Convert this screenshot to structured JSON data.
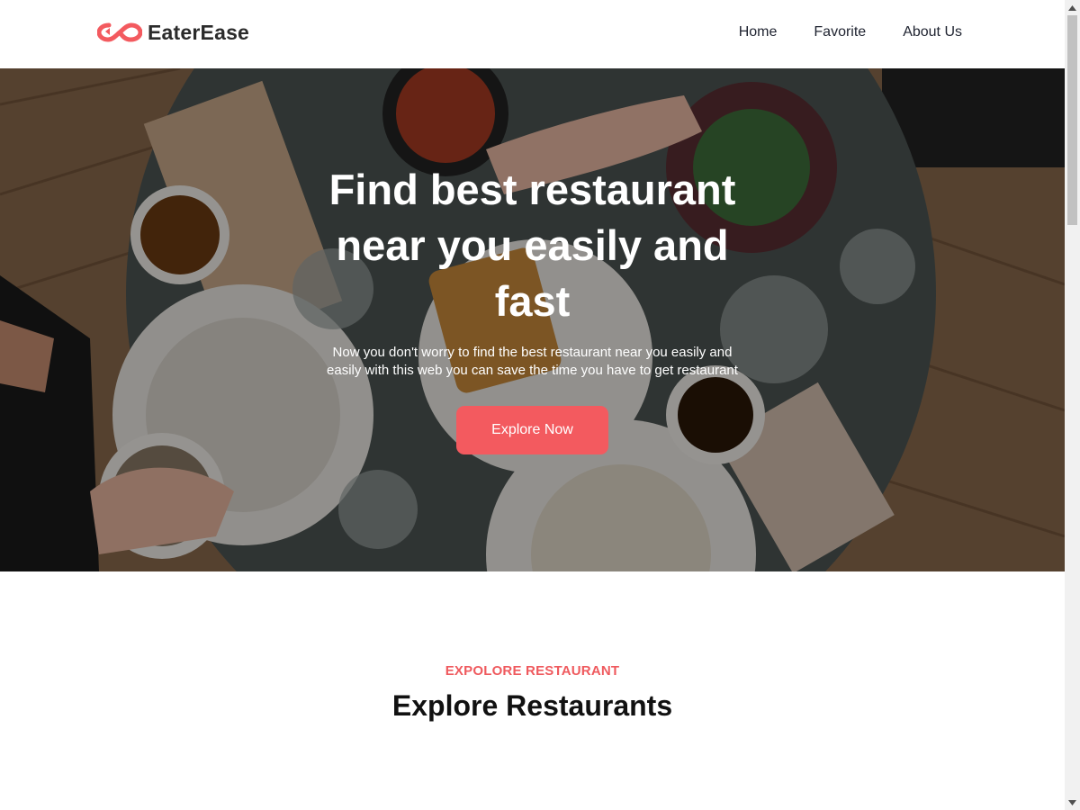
{
  "header": {
    "brand": "EaterEase",
    "nav": [
      {
        "label": "Home"
      },
      {
        "label": "Favorite"
      },
      {
        "label": "About Us"
      }
    ]
  },
  "hero": {
    "title": "Find best restaurant near you easily and fast",
    "subtitle": "Now you don't worry to find the best restaurant near you easily and easily with this web you can save the time you have to get restaurant",
    "cta_label": "Explore Now"
  },
  "explore": {
    "eyebrow": "EXPOLORE RESTAURANT",
    "title": "Explore Restaurants"
  },
  "colors": {
    "accent": "#f35a5f",
    "text_dark": "#111111"
  }
}
